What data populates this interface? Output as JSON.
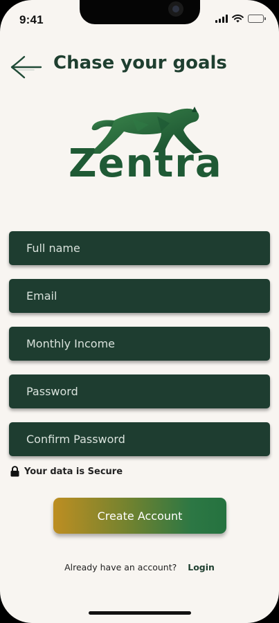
{
  "status_bar": {
    "time": "9:41"
  },
  "header": {
    "title": "Chase your goals",
    "back_icon": "arrow-left-icon"
  },
  "logo": {
    "brand_name": "Zentra",
    "mascot_icon": "panther-icon"
  },
  "form": {
    "full_name_placeholder": "Full name",
    "email_placeholder": "Email",
    "income_placeholder": "Monthly Income",
    "password_placeholder": "Password",
    "confirm_password_placeholder": "Confirm Password"
  },
  "security": {
    "icon": "lock-icon",
    "text": "Your data is Secure"
  },
  "actions": {
    "create_account_label": "Create Account",
    "login_prompt": "Already have an account?",
    "login_label": "Login"
  },
  "colors": {
    "background": "#f8f5f1",
    "field_background": "#1e3d30",
    "title_green": "#1f3f30",
    "brand_green": "#1f5a35",
    "button_gradient_start": "#bd8e22",
    "button_gradient_end": "#25723f"
  }
}
